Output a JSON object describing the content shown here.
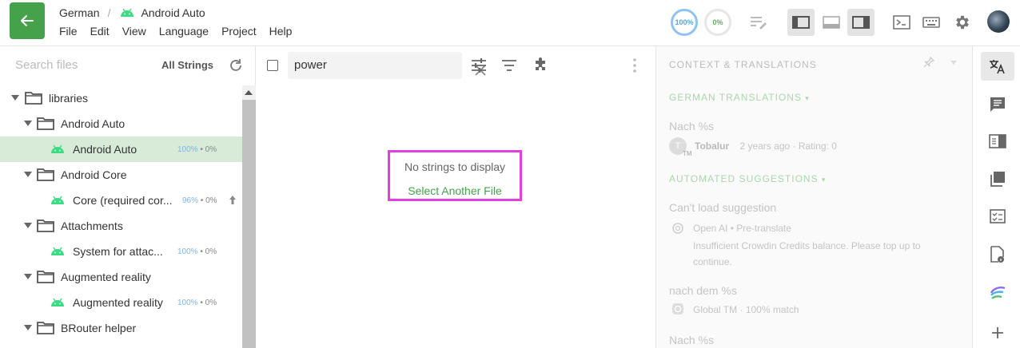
{
  "header": {
    "breadcrumb_language": "German",
    "breadcrumb_separator": "/",
    "breadcrumb_project": "Android Auto",
    "menu": [
      "File",
      "Edit",
      "View",
      "Language",
      "Project",
      "Help"
    ],
    "translated_progress": "100%",
    "proofread_progress": "0%"
  },
  "sidebar": {
    "search_placeholder": "Search files",
    "filter_label": "All Strings",
    "tree": [
      {
        "type": "folder",
        "label": "libraries",
        "level": 0
      },
      {
        "type": "folder",
        "label": "Android Auto",
        "level": 1
      },
      {
        "type": "file",
        "label": "Android Auto",
        "level": 2,
        "translated": "100%",
        "approved": "0%",
        "selected": true
      },
      {
        "type": "folder",
        "label": "Android Core",
        "level": 1
      },
      {
        "type": "file",
        "label": "Core (required cor...",
        "level": 2,
        "translated": "96%",
        "approved": "0%",
        "upload": true
      },
      {
        "type": "folder",
        "label": "Attachments",
        "level": 1
      },
      {
        "type": "file",
        "label": "System for attac...",
        "level": 2,
        "translated": "100%",
        "approved": "0%"
      },
      {
        "type": "folder",
        "label": "Augmented reality",
        "level": 1
      },
      {
        "type": "file",
        "label": "Augmented reality",
        "level": 2,
        "translated": "100%",
        "approved": "0%"
      },
      {
        "type": "folder",
        "label": "BRouter helper",
        "level": 1
      }
    ]
  },
  "strings": {
    "search_value": "power",
    "empty_message": "No strings to display",
    "select_another_file": "Select Another File"
  },
  "context": {
    "title": "CONTEXT & TRANSLATIONS",
    "german_translations_header": "GERMAN TRANSLATIONS",
    "translation_text": "Nach %s",
    "translator_avatar": "T",
    "translator_badge": "TM",
    "translator_name": "Tobalur",
    "translation_time": "2 years ago",
    "translation_rating": "Rating: 0",
    "automated_header": "AUTOMATED SUGGESTIONS",
    "suggestion1_text": "Can't load suggestion",
    "suggestion1_source": "Open AI • Pre-translate",
    "suggestion1_error_line1": "Insufficient Crowdin Credits balance. Please top up to",
    "suggestion1_error_line2": "continue.",
    "suggestion2_text": "nach dem %s",
    "suggestion2_source": "Global TM",
    "suggestion2_match": "100% match",
    "suggestion3_text": "Nach %s"
  },
  "colors": {
    "accent": "#45a24a",
    "selected_row": "#d8ebd8",
    "highlight_box": "#e040e0",
    "android": "#3ddc84"
  }
}
